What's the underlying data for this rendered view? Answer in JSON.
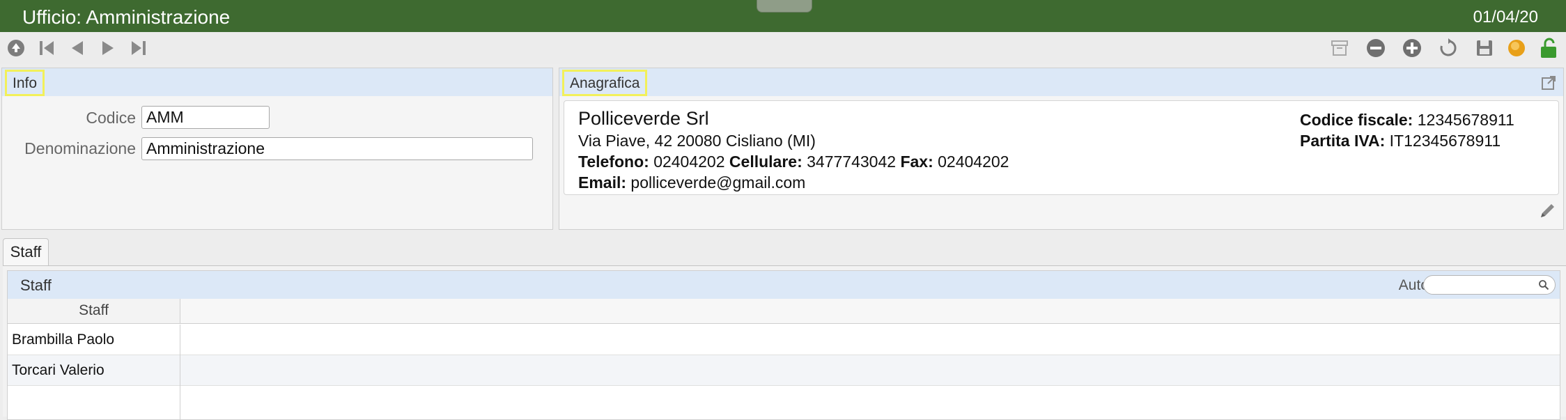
{
  "window": {
    "title": "Ufficio: Amministrazione",
    "date": "01/04/20"
  },
  "toolbar": {
    "nav_icons": [
      "up-circle-icon",
      "first-record-icon",
      "previous-record-icon",
      "next-record-icon",
      "last-record-icon"
    ],
    "action_icons": [
      "archive-icon",
      "remove-icon",
      "add-icon",
      "refresh-icon",
      "save-icon",
      "status-light-icon",
      "unlock-icon"
    ]
  },
  "info": {
    "title": "Info",
    "codice_label": "Codice",
    "codice_value": "AMM",
    "denominazione_label": "Denominazione",
    "denominazione_value": "Amministrazione"
  },
  "anagrafica": {
    "title": "Anagrafica",
    "company_name": "Polliceverde Srl",
    "address": "Via Piave, 42 20080 Cisliano (MI)",
    "telefono_label": "Telefono:",
    "telefono_value": "02404202",
    "cellulare_label": "Cellulare:",
    "cellulare_value": "3477743042",
    "fax_label": "Fax:",
    "fax_value": "02404202",
    "email_label": "Email:",
    "email_value": "polliceverde@gmail.com",
    "codice_fiscale_label": "Codice fiscale:",
    "codice_fiscale_value": "12345678911",
    "partita_iva_label": "Partita IVA:",
    "partita_iva_value": "IT12345678911"
  },
  "tabs": [
    {
      "label": "Staff"
    }
  ],
  "staff_grid": {
    "title": "Staff",
    "auto_label": "Auto",
    "search_value": "",
    "column_header": "Staff",
    "rows": [
      {
        "name": "Brambilla Paolo"
      },
      {
        "name": "Torcari Valerio"
      }
    ]
  },
  "colors": {
    "titlebar": "#3e6a30",
    "panel_header": "#dce8f7",
    "highlight": "#f2f05a",
    "lock_green": "#3a9a2e"
  }
}
